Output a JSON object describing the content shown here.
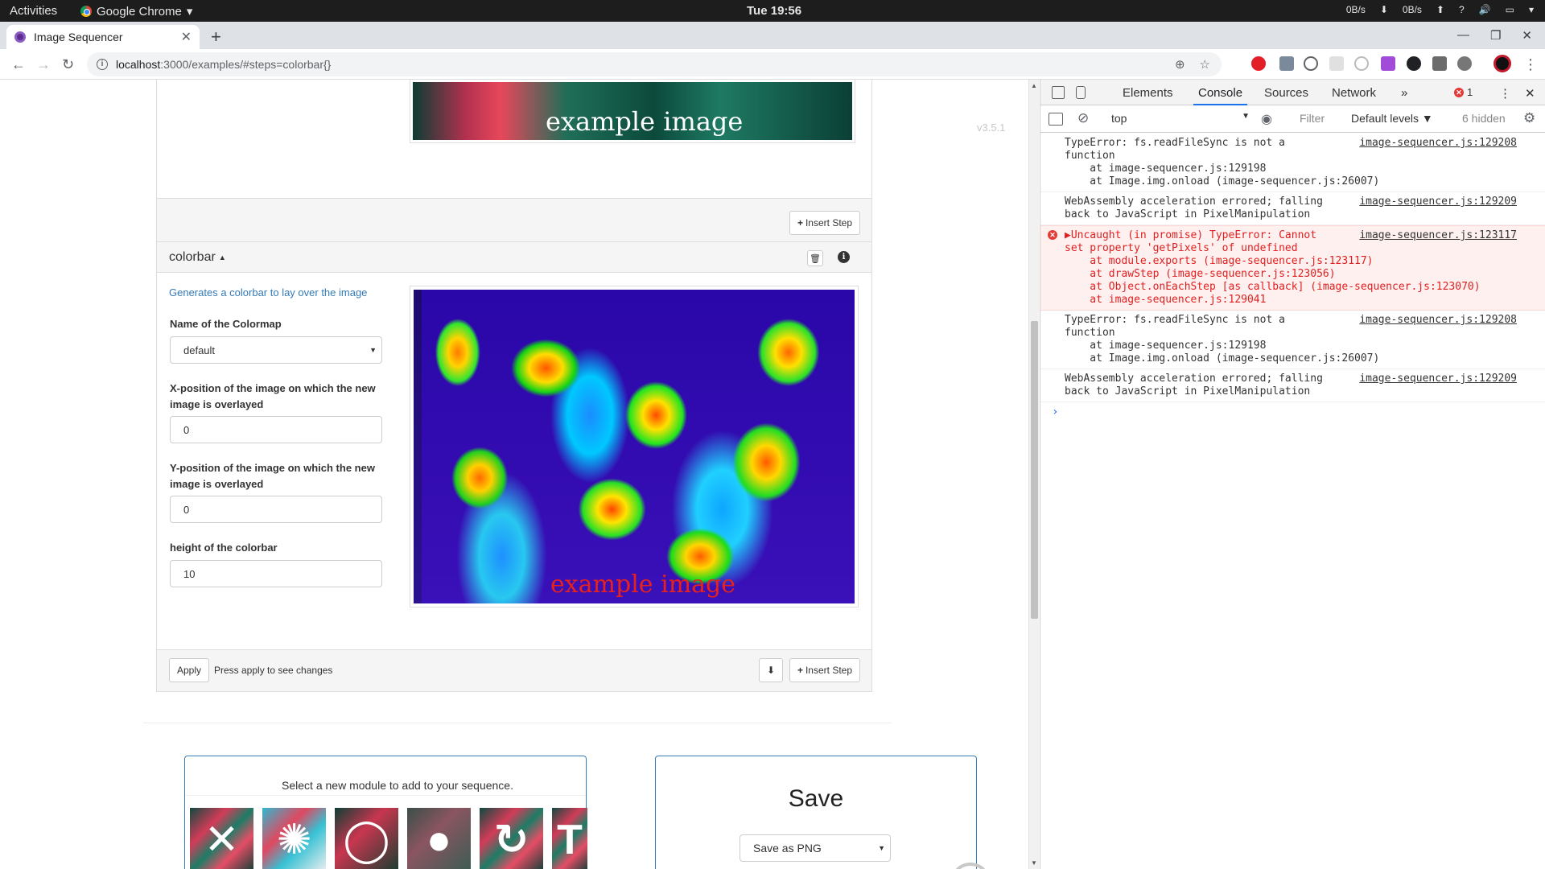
{
  "system_bar": {
    "activities": "Activities",
    "app_name": "Google Chrome",
    "app_caret": "▾",
    "clock": "Tue 19:56",
    "net_down": "0B/s",
    "net_up": "0B/s"
  },
  "browser": {
    "tab_title": "Image Sequencer",
    "url_host": "localhost",
    "url_path": ":3000/examples/#steps=colorbar{}"
  },
  "page": {
    "version": "v3.5.1",
    "previous_step": {
      "watermark": "example image",
      "insert_step_label": "Insert Step"
    },
    "colorbar_step": {
      "title": "colorbar",
      "description": "Generates a colorbar to lay over the image",
      "fields": [
        {
          "label": "Name of the Colormap",
          "value": "default"
        },
        {
          "label": "X-position of the image on which the new image is overlayed",
          "value": "0"
        },
        {
          "label": "Y-position of the image on which the new image is overlayed",
          "value": "0"
        },
        {
          "label": "height of the colorbar",
          "value": "10"
        }
      ],
      "watermark": "example image",
      "apply_label": "Apply",
      "apply_note": "Press apply to see changes",
      "insert_step_label": "Insert Step"
    },
    "add_module": {
      "message": "Select a new module to add to your sequence."
    },
    "save": {
      "title": "Save",
      "format_selected": "Save as PNG"
    }
  },
  "devtools": {
    "tabs": [
      "Elements",
      "Console",
      "Sources",
      "Network"
    ],
    "active_tab": "Console",
    "more_tabs": "»",
    "error_count": "1",
    "context": "top",
    "filter_placeholder": "Filter",
    "levels": "Default levels",
    "hidden_count": "6 hidden",
    "messages": [
      {
        "type": "log",
        "text": "TypeError: fs.readFileSync is not a\nfunction",
        "stack": [
          "    at image-sequencer.js:129198",
          "    at Image.img.onload (image-sequencer.js:26007)"
        ],
        "source": "image-sequencer.js:129208"
      },
      {
        "type": "log",
        "text": "WebAssembly acceleration errored; falling\nback to JavaScript in PixelManipulation",
        "stack": [],
        "source": "image-sequencer.js:129209"
      },
      {
        "type": "error",
        "text": "▶Uncaught (in promise) TypeError: Cannot\nset property 'getPixels' of undefined",
        "stack": [
          "    at module.exports (image-sequencer.js:123117)",
          "    at drawStep (image-sequencer.js:123056)",
          "    at Object.onEachStep [as callback] (image-sequencer.js:123070)",
          "    at image-sequencer.js:129041"
        ],
        "source": "image-sequencer.js:123117"
      },
      {
        "type": "log",
        "text": "TypeError: fs.readFileSync is not a\nfunction",
        "stack": [
          "    at image-sequencer.js:129198",
          "    at Image.img.onload (image-sequencer.js:26007)"
        ],
        "source": "image-sequencer.js:129208"
      },
      {
        "type": "log",
        "text": "WebAssembly acceleration errored; falling\nback to JavaScript in PixelManipulation",
        "stack": [],
        "source": "image-sequencer.js:129209"
      }
    ],
    "prompt": "›"
  }
}
